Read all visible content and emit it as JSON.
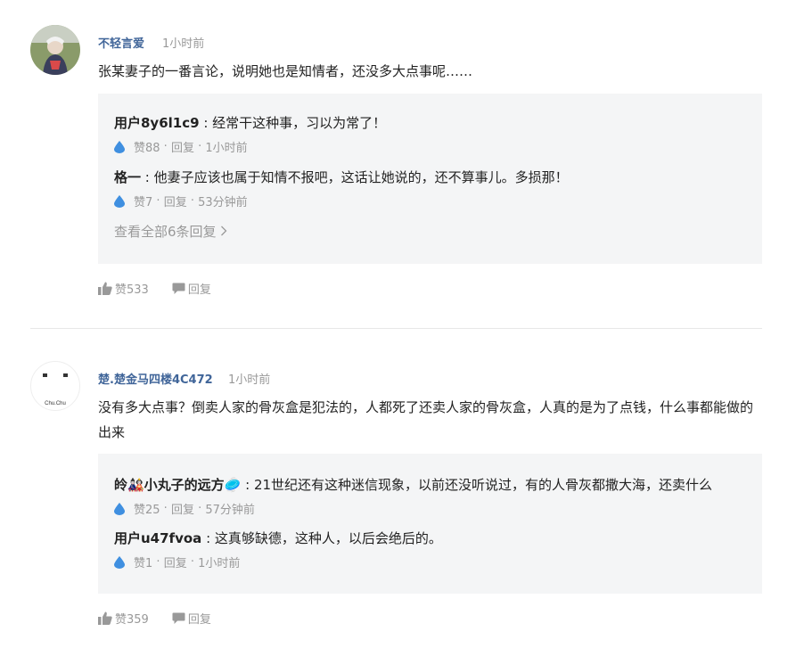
{
  "comments": [
    {
      "username": "不轻言爱",
      "time": "1小时前",
      "content": "张某妻子的一番言论，说明她也是知情者，还没多大点事呢……",
      "replies": [
        {
          "user": "用户8y6l1c9",
          "sep": " : ",
          "text": "经常干这种事，习以为常了！",
          "likes": "赞88",
          "reply_label": "回复",
          "time": "1小时前"
        },
        {
          "user": "格一",
          "sep": " : ",
          "text": "他妻子应该也属于知情不报吧，这话让她说的，还不算事儿。多损那！",
          "likes": "赞7",
          "reply_label": "回复",
          "time": "53分钟前"
        }
      ],
      "view_all": "查看全部6条回复",
      "like_count": "赞533",
      "reply_label": "回复"
    },
    {
      "username": "楚.楚金马四楼4C472",
      "time": "1小时前",
      "avatar_text": "Chu.Chu",
      "content": "没有多大点事？倒卖人家的骨灰盒是犯法的，人都死了还卖人家的骨灰盒，人真的是为了点钱，什么事都能做的出来",
      "replies": [
        {
          "user": "皊🎎小丸子的远方🥏",
          "sep": " : ",
          "text": "21世纪还有这种迷信现象，以前还没听说过，有的人骨灰都撒大海，还卖什么",
          "likes": "赞25",
          "reply_label": "回复",
          "time": "57分钟前"
        },
        {
          "user": "用户u47fvoa",
          "sep": " : ",
          "text": "这真够缺德，这种人，以后会绝后的。",
          "likes": "赞1",
          "reply_label": "回复",
          "time": "1小时前"
        }
      ],
      "like_count": "赞359",
      "reply_label": "回复"
    }
  ],
  "colors": {
    "username": "#406599",
    "muted": "#999999",
    "reply_bg": "#f4f5f6",
    "drop": "#3f8fe0"
  }
}
